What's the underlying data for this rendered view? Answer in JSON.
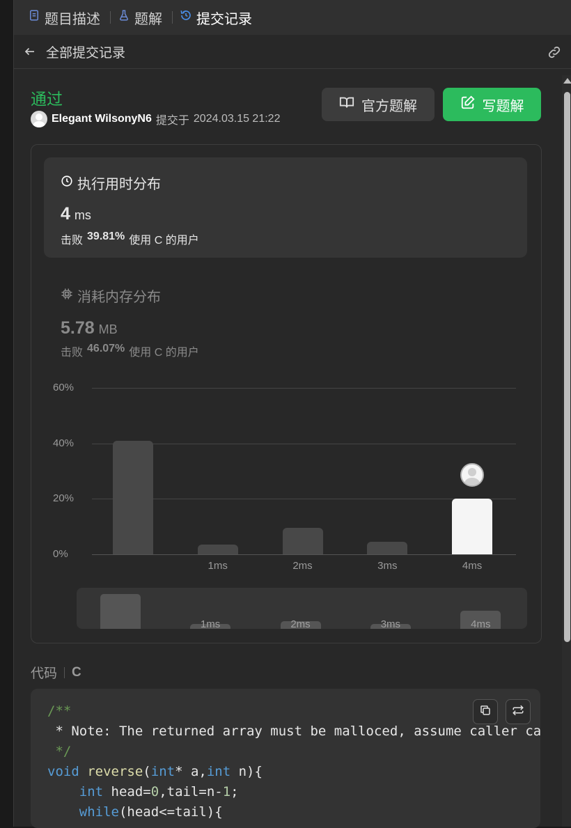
{
  "tabs": [
    {
      "label": "题目描述",
      "icon": "document-icon"
    },
    {
      "label": "题解",
      "icon": "flask-icon"
    },
    {
      "label": "提交记录",
      "icon": "history-icon",
      "active": true
    }
  ],
  "subheader": {
    "title": "全部提交记录",
    "back_icon": "arrow-left-icon",
    "link_icon": "link-icon"
  },
  "submission": {
    "status": "通过",
    "user": "Elegant WilsonyN6",
    "submitted_prefix": "提交于",
    "submitted_at": "2024.03.15 21:22"
  },
  "actions": {
    "official_label": "官方题解",
    "write_label": "写题解"
  },
  "runtime": {
    "title": "执行用时分布",
    "value": "4",
    "unit": "ms",
    "beat_prefix": "击败",
    "beat_pct": "39.81%",
    "beat_suffix": "使用 C 的用户"
  },
  "memory": {
    "title": "消耗内存分布",
    "value": "5.78",
    "unit": "MB",
    "beat_prefix": "击败",
    "beat_pct": "46.07%",
    "beat_suffix": "使用 C 的用户"
  },
  "chart_data": {
    "type": "bar",
    "categories": [
      "",
      "1ms",
      "2ms",
      "3ms",
      "4ms"
    ],
    "values": [
      41,
      3.5,
      9.5,
      4.5,
      20
    ],
    "ylim": [
      0,
      60
    ],
    "yticks": [
      "60%",
      "40%",
      "20%",
      "0%"
    ],
    "selected_index": 4,
    "grid": true
  },
  "brush": {
    "values": [
      12.5,
      1.8,
      2.8,
      1.8,
      6.5
    ],
    "labels": [
      "",
      "1ms",
      "2ms",
      "3ms",
      "4ms"
    ]
  },
  "code_section": {
    "label": "代码",
    "language": "C"
  }
}
